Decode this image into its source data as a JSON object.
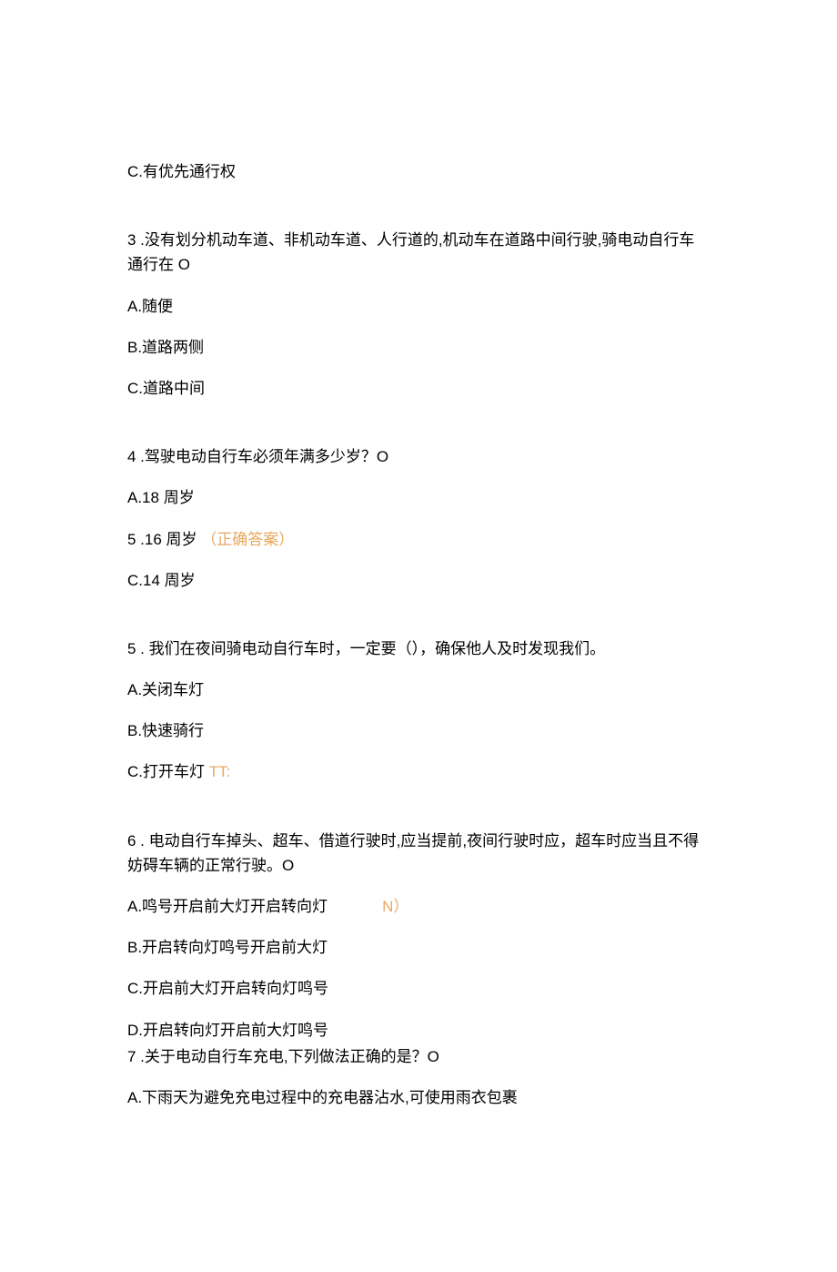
{
  "orphan": {
    "c": "C.有优先通行权"
  },
  "q3": {
    "stem": "3 .没有划分机动车道、非机动车道、人行道的,机动车在道路中间行驶,骑电动自行车通行在 O",
    "a": "A.随便",
    "b": "B.道路两侧",
    "c": "C.道路中间"
  },
  "q4": {
    "stem": "4 .驾驶电动自行车必须年满多少岁？O",
    "a": "A.18 周岁",
    "b_prefix": "5  .16 周岁",
    "b_hint": "（正确答案）",
    "c": "C.14 周岁"
  },
  "q5": {
    "stem": "5 . 我们在夜间骑电动自行车时，一定要（），确保他人及时发现我们。",
    "a": "A.关闭车灯",
    "b": "B.快速骑行",
    "c_prefix": "C.打开车灯",
    "c_hint": "TT:"
  },
  "q6": {
    "stem": "6 . 电动自行车掉头、超车、借道行驶时,应当提前,夜间行驶时应，超车时应当且不得妨碍车辆的正常行驶。O",
    "a_prefix": "A.鸣号开启前大灯开启转向灯",
    "a_hint": "N）",
    "b": "B.开启转向灯鸣号开启前大灯",
    "c": "C.开启前大灯开启转向灯鸣号",
    "d": "D.开启转向灯开启前大灯鸣号"
  },
  "q7": {
    "stem": "7  .关于电动自行车充电,下列做法正确的是？O",
    "a": "A.下雨天为避免充电过程中的充电器沾水,可使用雨衣包裹"
  }
}
